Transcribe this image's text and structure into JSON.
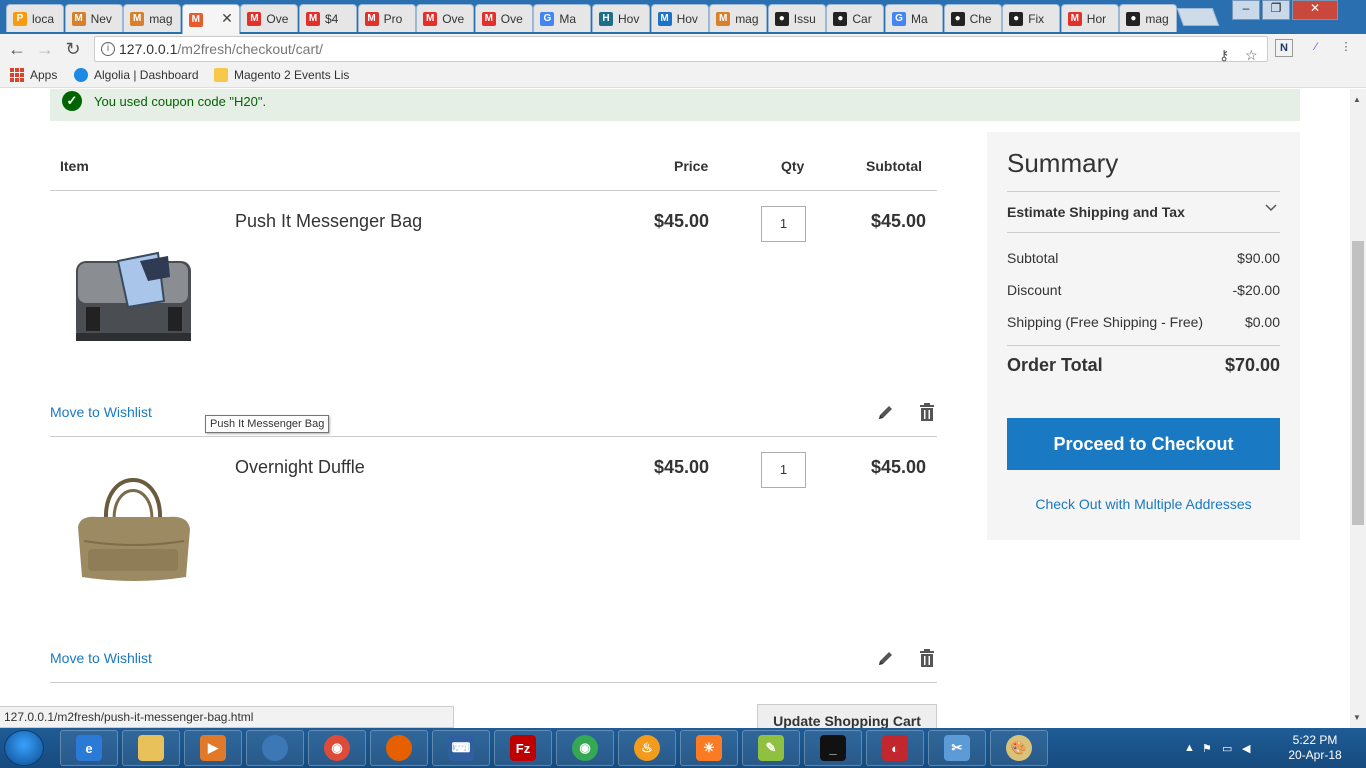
{
  "browser": {
    "tabs": [
      {
        "label": "loca",
        "icon": "phpmyadmin-icon",
        "color": "#f89c0e"
      },
      {
        "label": "Nev",
        "icon": "magento-icon",
        "color": "#d8802a"
      },
      {
        "label": "mag",
        "icon": "magento-icon",
        "color": "#d8802a"
      },
      {
        "label": "",
        "icon": "magento-icon",
        "color": "#e85b2c",
        "active": true
      },
      {
        "label": "Ove",
        "icon": "magento-icon",
        "color": "#e2312b"
      },
      {
        "label": "$4",
        "icon": "magento-icon",
        "color": "#e2312b"
      },
      {
        "label": "Pro",
        "icon": "magento-icon",
        "color": "#e2312b"
      },
      {
        "label": "Ove",
        "icon": "magento-icon",
        "color": "#e2312b"
      },
      {
        "label": "Ove",
        "icon": "magento-icon",
        "color": "#e2312b"
      },
      {
        "label": "Ma",
        "icon": "google-icon",
        "color": "#4285f4"
      },
      {
        "label": "Hov",
        "icon": "hubspot-icon",
        "color": "#1f6f8b"
      },
      {
        "label": "Hov",
        "icon": "m-icon",
        "color": "#1b74c9"
      },
      {
        "label": "mag",
        "icon": "magento-icon",
        "color": "#d8802a"
      },
      {
        "label": "Issu",
        "icon": "github-icon",
        "color": "#222222"
      },
      {
        "label": "Car",
        "icon": "github-icon",
        "color": "#222222"
      },
      {
        "label": "Ma",
        "icon": "google-icon",
        "color": "#4285f4"
      },
      {
        "label": "Che",
        "icon": "github-icon",
        "color": "#222222"
      },
      {
        "label": "Fix",
        "icon": "github-icon",
        "color": "#222222"
      },
      {
        "label": "Hor",
        "icon": "magento-icon",
        "color": "#e2312b"
      },
      {
        "label": "mag",
        "icon": "github-icon",
        "color": "#222222"
      }
    ],
    "url_host": "127.0.0.1",
    "url_path": "/m2fresh/checkout/cart/",
    "bookmarks": {
      "apps": "Apps",
      "algolia": "Algolia | Dashboard",
      "magento_events": "Magento 2 Events Lis"
    },
    "status_url": "127.0.0.1/m2fresh/push-it-messenger-bag.html"
  },
  "page": {
    "message": "You used coupon code \"H20\".",
    "columns": {
      "item": "Item",
      "price": "Price",
      "qty": "Qty",
      "subtotal": "Subtotal"
    },
    "items": [
      {
        "name": "Push It Messenger Bag",
        "price": "$45.00",
        "qty": "1",
        "subtotal": "$45.00",
        "wishlist": "Move to Wishlist",
        "tooltip": "Push It Messenger Bag"
      },
      {
        "name": "Overnight Duffle",
        "price": "$45.00",
        "qty": "1",
        "subtotal": "$45.00",
        "wishlist": "Move to Wishlist"
      }
    ],
    "update_cart": "Update Shopping Cart"
  },
  "summary": {
    "title": "Summary",
    "estimate": "Estimate Shipping and Tax",
    "subtotal_label": "Subtotal",
    "subtotal_value": "$90.00",
    "discount_label": "Discount",
    "discount_value": "-$20.00",
    "shipping_label": "Shipping (Free Shipping - Free)",
    "shipping_value": "$0.00",
    "total_label": "Order Total",
    "total_value": "$70.00",
    "checkout": "Proceed to Checkout",
    "multi": "Check Out with Multiple Addresses"
  },
  "taskbar": {
    "time": "5:22 PM",
    "date": "20-Apr-18"
  },
  "colors": {
    "accent": "#1979c3",
    "success_bg": "#e5efe5",
    "success_text": "#006400"
  }
}
